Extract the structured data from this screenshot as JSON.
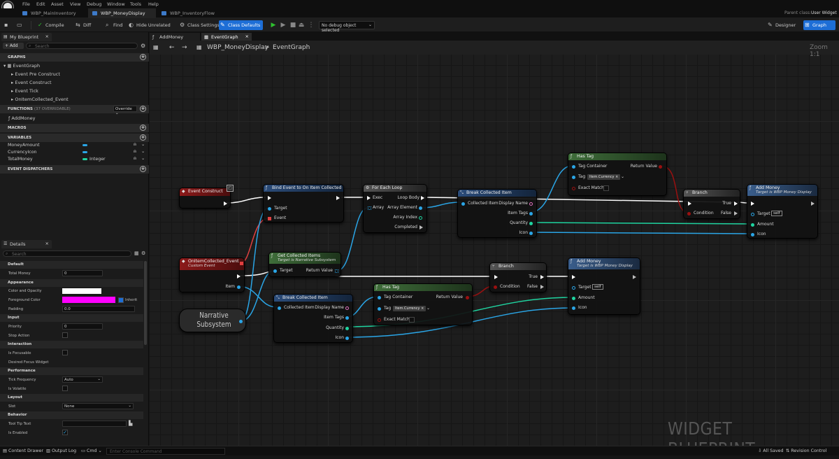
{
  "menu": [
    "File",
    "Edit",
    "Asset",
    "View",
    "Debug",
    "Window",
    "Tools",
    "Help"
  ],
  "doc_tabs": [
    "WBP_MainInventory",
    "WBP_MoneyDisplay",
    "WBP_InventoryFlow"
  ],
  "parent_class": {
    "label": "Parent class:",
    "value": "User Widget"
  },
  "toolbar": {
    "compile": "Compile",
    "diff": "Diff",
    "find": "Find",
    "hide_unrelated": "Hide Unrelated",
    "class_settings": "Class Settings",
    "class_defaults": "Class Defaults",
    "debug_object": "No debug object selected",
    "designer": "Designer",
    "graph": "Graph"
  },
  "my_blueprint": {
    "tab": "My Blueprint",
    "add": "+ Add",
    "search_placeholder": "Search",
    "graphs_header": "GRAPHS",
    "event_graph": "EventGraph",
    "events": [
      "Event Pre Construct",
      "Event Construct",
      "Event Tick",
      "OnItemCollected_Event"
    ],
    "functions_header": "FUNCTIONS",
    "functions_count": "(37 OVERRIDABLE)",
    "override": "Override",
    "function_items": [
      "AddMoney"
    ],
    "macros_header": "MACROS",
    "variables_header": "VARIABLES",
    "variables": [
      {
        "name": "MoneyAmount",
        "type": "",
        "color": "#2aa5e6"
      },
      {
        "name": "CurrencyIcon",
        "type": "",
        "color": "#2aa5e6"
      },
      {
        "name": "TotalMoney",
        "type": "Integer",
        "color": "#1fd4a0"
      }
    ],
    "dispatchers_header": "EVENT DISPATCHERS"
  },
  "details": {
    "tab": "Details",
    "search_placeholder": "Search",
    "sections": {
      "default": "Default",
      "appearance": "Appearance",
      "input": "Input",
      "interaction": "Interaction",
      "performance": "Performance",
      "layout": "Layout",
      "behavior": "Behavior"
    },
    "total_money_label": "Total Money",
    "total_money_value": "0",
    "color_opacity": "Color and Opacity",
    "foreground_color": "Foreground Color",
    "inherit": "Inherit",
    "padding": "Padding",
    "padding_value": "0.0",
    "priority": "Priority",
    "priority_value": "0",
    "stop_action": "Stop Action",
    "is_focusable": "Is Focusable",
    "desired_focus": "Desired Focus Widget",
    "tick_frequency": "Tick Frequency",
    "tick_value": "Auto",
    "is_volatile": "Is Volatile",
    "slot": "Slot",
    "slot_value": "None",
    "tooltip": "Tool Tip Text",
    "is_enabled": "Is Enabled"
  },
  "graph": {
    "tabs": [
      "AddMoney",
      "EventGraph"
    ],
    "crumb_root": "WBP_MoneyDisplay",
    "crumb_leaf": "EventGraph",
    "zoom": "Zoom 1:1",
    "watermark": "WIDGET BLUEPRINT"
  },
  "nodes": {
    "event_construct": {
      "title": "Event Construct"
    },
    "bind_event": {
      "title": "Bind Event to On Item Collected",
      "target": "Target",
      "event": "Event"
    },
    "for_each": {
      "title": "For Each Loop",
      "exec": "Exec",
      "array": "Array",
      "loop_body": "Loop Body",
      "array_element": "Array Element",
      "array_index": "Array Index",
      "completed": "Completed"
    },
    "break_item_1": {
      "title": "Break Collected Item",
      "collected_item": "Collected Item",
      "display_name": "Display Name",
      "item_tags": "Item Tags",
      "quantity": "Quantity",
      "icon": "Icon"
    },
    "has_tag_1": {
      "title": "Has Tag",
      "tag_container": "Tag Container",
      "return_value": "Return Value",
      "tag": "Tag",
      "tag_value": "Item.Currency",
      "exact_match": "Exact Match"
    },
    "branch_1": {
      "title": "Branch",
      "true": "True",
      "condition": "Condition",
      "false": "False"
    },
    "add_money_1": {
      "title": "Add Money",
      "subtitle": "Target is WBP Money Display",
      "target": "Target",
      "self": "self",
      "amount": "Amount",
      "icon": "Icon"
    },
    "on_item_collected": {
      "title": "OnItemCollected_Event",
      "subtitle": "Custom Event",
      "item": "Item"
    },
    "get_collected": {
      "title": "Get Collected Items",
      "subtitle": "Target is Narrative Subsystem",
      "target": "Target",
      "return_value": "Return Value"
    },
    "narrative": {
      "title": "Narrative Subsystem"
    },
    "break_item_2": {
      "title": "Break Collected Item",
      "collected_item": "Collected Item",
      "display_name": "Display Name",
      "item_tags": "Item Tags",
      "quantity": "Quantity",
      "icon": "Icon"
    },
    "has_tag_2": {
      "title": "Has Tag",
      "tag_container": "Tag Container",
      "return_value": "Return Value",
      "tag": "Tag",
      "tag_value": "Item.Currency",
      "exact_match": "Exact Match"
    },
    "branch_2": {
      "title": "Branch",
      "true": "True",
      "condition": "Condition",
      "false": "False"
    },
    "add_money_2": {
      "title": "Add Money",
      "subtitle": "Target is WBP Money Display",
      "target": "Target",
      "self": "self",
      "amount": "Amount",
      "icon": "Icon"
    }
  },
  "statusbar": {
    "content_drawer": "Content Drawer",
    "output_log": "Output Log",
    "cmd": "Cmd",
    "console_placeholder": "Enter Console Command",
    "all_saved": "All Saved",
    "revision": "Revision Control"
  },
  "colors": {
    "accent": "#1d6ed6",
    "event": "#7a1414",
    "function": "#1f3f66",
    "pure": "#3f6e3a",
    "exec": "#ffffff",
    "object_pin": "#2aa5e6",
    "int_pin": "#1fd4a0",
    "bool_pin": "#8b0d0d",
    "foreground": "#ff00ff"
  }
}
